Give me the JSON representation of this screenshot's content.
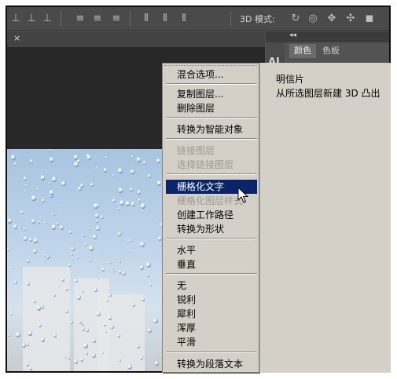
{
  "toolbar": {
    "mode_label": "3D 模式:",
    "align_icons": [
      "align-top-icon",
      "align-vcenter-icon",
      "align-bottom-icon",
      "align-left-icon",
      "align-hcenter-icon",
      "align-right-icon"
    ],
    "distribute_icons": [
      "distribute-top-icon",
      "distribute-vcenter-icon",
      "distribute-bottom-icon",
      "distribute-left-icon",
      "distribute-hcenter-icon",
      "distribute-right-icon"
    ],
    "mode_icons": [
      "3d-rotate-icon",
      "3d-roll-icon",
      "3d-pan-icon",
      "3d-slide-icon",
      "3d-camera-icon"
    ]
  },
  "document_tab": {
    "close_label": "×"
  },
  "panel": {
    "collapse_label": "◂◂",
    "tabs": [
      "颜色",
      "色板"
    ],
    "tool_icon_label": "AI"
  },
  "context_menu": {
    "items": [
      {
        "label": "混合选项...",
        "enabled": true
      },
      {
        "label": "复制图层...",
        "enabled": true
      },
      {
        "label": "删除图层",
        "enabled": true
      },
      {
        "label": "转换为智能对象",
        "enabled": true
      },
      {
        "label": "链接图层",
        "enabled": false
      },
      {
        "label": "选择链接图层",
        "enabled": false
      },
      {
        "label": "栅格化文字",
        "enabled": true,
        "highlighted": true
      },
      {
        "label": "栅格化图层样式",
        "enabled": false
      },
      {
        "label": "创建工作路径",
        "enabled": true
      },
      {
        "label": "转换为形状",
        "enabled": true
      },
      {
        "label": "水平",
        "enabled": true
      },
      {
        "label": "垂直",
        "enabled": true
      },
      {
        "label": "无",
        "enabled": true
      },
      {
        "label": "锐利",
        "enabled": true
      },
      {
        "label": "犀利",
        "enabled": true
      },
      {
        "label": "浑厚",
        "enabled": true
      },
      {
        "label": "平滑",
        "enabled": true
      },
      {
        "label": "转换为段落文本",
        "enabled": true
      }
    ]
  },
  "submenu": {
    "items": [
      "明信片",
      "从所选图层新建 3D 凸出"
    ]
  },
  "colors": {
    "highlight": "#0a246a",
    "menu_bg": "#d4d0c8",
    "disabled_text": "#9c9a94"
  }
}
